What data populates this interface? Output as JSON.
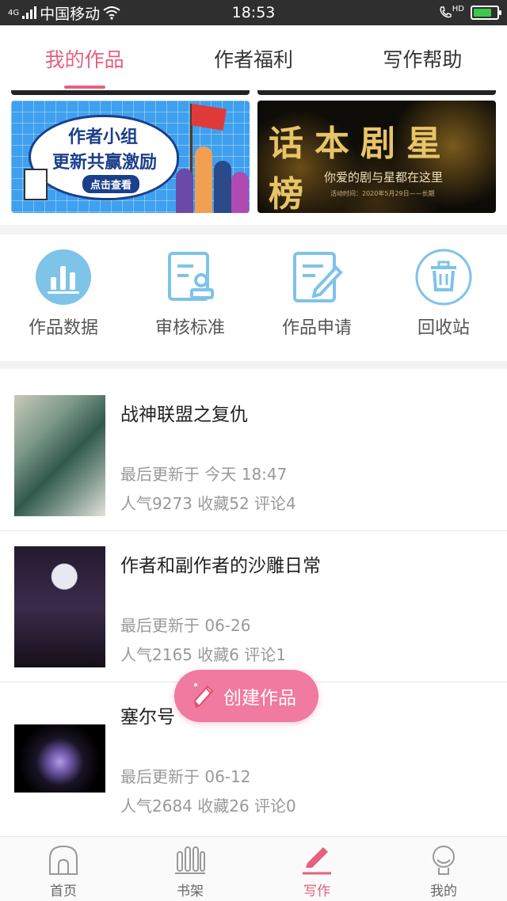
{
  "status_bar": {
    "network": "4G",
    "carrier": "中国移动",
    "time": "18:53",
    "hd": "HD",
    "battery_level": 0.8
  },
  "top_tabs": [
    {
      "label": "我的作品",
      "active": true
    },
    {
      "label": "作者福利",
      "active": false
    },
    {
      "label": "写作帮助",
      "active": false
    }
  ],
  "banners": {
    "left": {
      "line1": "作者小组",
      "line2": "更新共赢激励",
      "button": "点击查看"
    },
    "right": {
      "headline": "话本剧星榜",
      "subtitle": "你爱的剧与星都在这里",
      "note": "活动时间：2020年5月29日——长期"
    }
  },
  "menu": [
    {
      "label": "作品数据",
      "icon": "bar-chart-icon"
    },
    {
      "label": "审核标准",
      "icon": "review-stamp-icon"
    },
    {
      "label": "作品申请",
      "icon": "edit-document-icon"
    },
    {
      "label": "回收站",
      "icon": "trash-icon"
    }
  ],
  "works": [
    {
      "title": "战神联盟之复仇",
      "updated": "最后更新于 今天 18:47",
      "stats": "人气9273 收藏52 评论4"
    },
    {
      "title": "作者和副作者的沙雕日常",
      "updated": "最后更新于 06-26",
      "stats": "人气2165 收藏6 评论1"
    },
    {
      "title": "塞尔号",
      "updated": "最后更新于 06-12",
      "stats": "人气2684 收藏26 评论0"
    }
  ],
  "fab": {
    "label": "创建作品"
  },
  "bottom_nav": [
    {
      "label": "首页",
      "icon": "home-icon",
      "active": false
    },
    {
      "label": "书架",
      "icon": "bookshelf-icon",
      "active": false
    },
    {
      "label": "写作",
      "icon": "pen-icon",
      "active": true
    },
    {
      "label": "我的",
      "icon": "profile-icon",
      "active": false
    }
  ],
  "colors": {
    "accent": "#e5607e",
    "fab": "#f07aa0",
    "menu_icon": "#7ec3e8",
    "muted_text": "#999999"
  }
}
